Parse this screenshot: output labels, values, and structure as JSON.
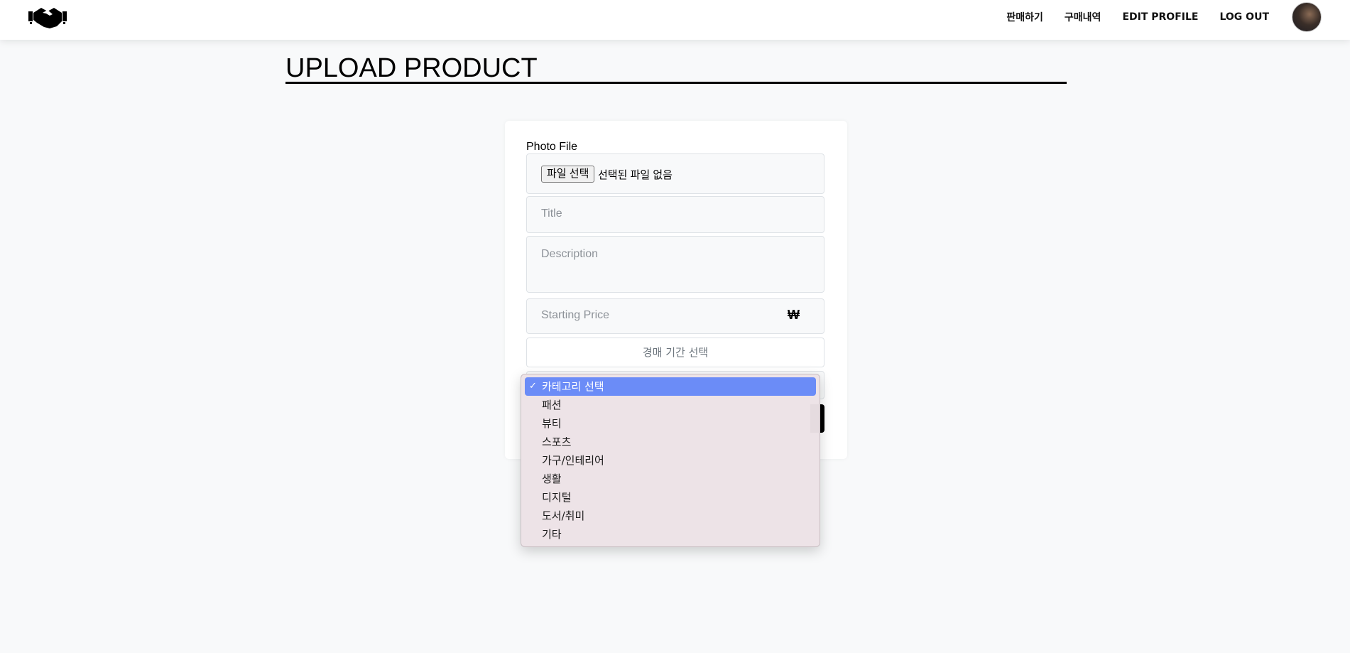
{
  "nav": {
    "links": [
      "판매하기",
      "구매내역",
      "EDIT PROFILE",
      "LOG OUT"
    ]
  },
  "page": {
    "title": "UPLOAD PRODUCT"
  },
  "form": {
    "photo_label": "Photo File",
    "file_button": "파일 선택",
    "file_status": "선택된 파일 없음",
    "title_placeholder": "Title",
    "description_placeholder": "Description",
    "price_placeholder": "Starting Price",
    "currency_symbol": "₩",
    "period_button": "경매 기간 선택"
  },
  "category_dropdown": {
    "selected_check": "✓",
    "options": [
      "카테고리 선택",
      "패션",
      "뷰티",
      "스포츠",
      "가구/인테리어",
      "생활",
      "디지털",
      "도서/취미",
      "기타"
    ]
  },
  "colors": {
    "accent_selected": "#6b8cf7",
    "dropdown_bg": "#ece2e6",
    "page_bg": "#f8f9fa"
  }
}
